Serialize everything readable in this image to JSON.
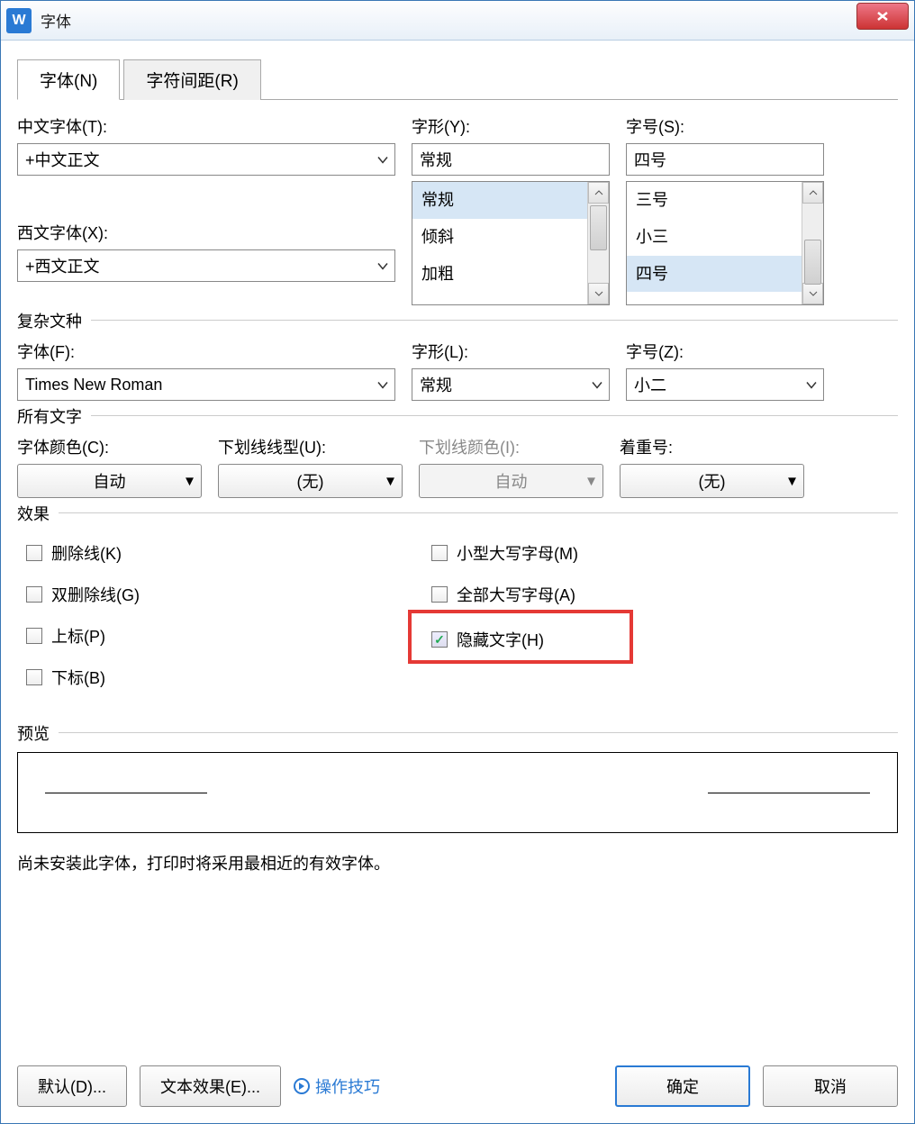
{
  "window": {
    "title": "字体"
  },
  "tabs": {
    "font": "字体(N)",
    "spacing": "字符间距(R)"
  },
  "font_section": {
    "cn_font_label": "中文字体(T):",
    "cn_font_value": "+中文正文",
    "en_font_label": "西文字体(X):",
    "en_font_value": "+西文正文",
    "style_label": "字形(Y):",
    "style_value": "常规",
    "style_options": [
      "常规",
      "倾斜",
      "加粗"
    ],
    "size_label": "字号(S):",
    "size_value": "四号",
    "size_options": [
      "三号",
      "小三",
      "四号"
    ]
  },
  "complex": {
    "title": "复杂文种",
    "font_label": "字体(F):",
    "font_value": "Times New Roman",
    "style_label": "字形(L):",
    "style_value": "常规",
    "size_label": "字号(Z):",
    "size_value": "小二"
  },
  "all_text": {
    "title": "所有文字",
    "color_label": "字体颜色(C):",
    "color_value": "自动",
    "underline_label": "下划线线型(U):",
    "underline_value": "(无)",
    "ul_color_label": "下划线颜色(I):",
    "ul_color_value": "自动",
    "emphasis_label": "着重号:",
    "emphasis_value": "(无)"
  },
  "effects": {
    "title": "效果",
    "strike": "删除线(K)",
    "dblstrike": "双删除线(G)",
    "superscript": "上标(P)",
    "subscript": "下标(B)",
    "smallcaps": "小型大写字母(M)",
    "allcaps": "全部大写字母(A)",
    "hidden": "隐藏文字(H)"
  },
  "preview": {
    "title": "预览"
  },
  "info_text": "尚未安装此字体，打印时将采用最相近的有效字体。",
  "buttons": {
    "default": "默认(D)...",
    "text_effects": "文本效果(E)...",
    "tips": "操作技巧",
    "ok": "确定",
    "cancel": "取消"
  }
}
